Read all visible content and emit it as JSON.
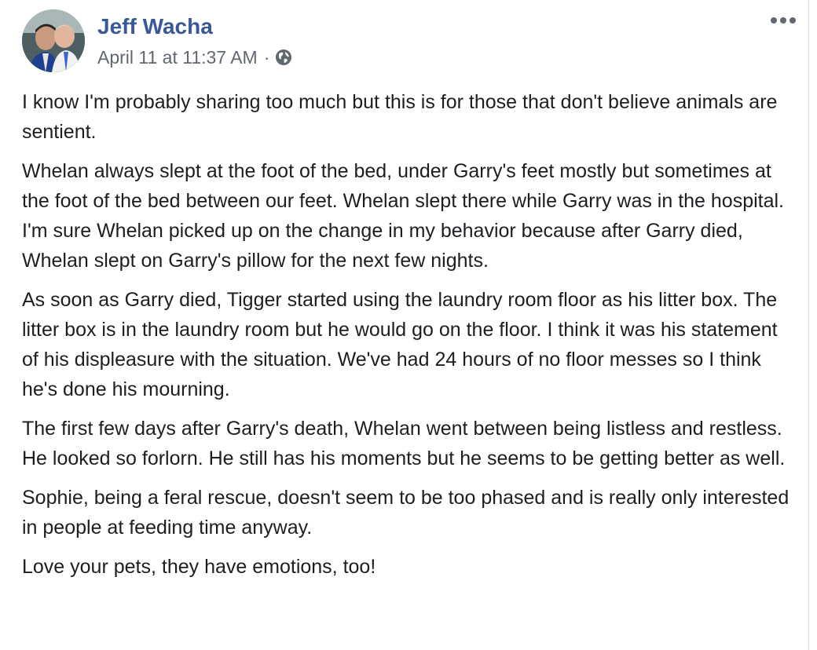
{
  "post": {
    "author": "Jeff Wacha",
    "timestamp": "April 11 at 11:37 AM",
    "separator": "·",
    "privacy_icon": "globe-icon",
    "more_icon": "more-options-icon",
    "paragraphs": [
      "I know I'm probably sharing too much but this is for those that don't believe animals are sentient.",
      "Whelan always slept at the foot of the bed, under Garry's feet mostly but sometimes at the foot of the bed between our feet. Whelan slept there while Garry was in the hospital. I'm sure Whelan picked up on the change in my behavior because after Garry died, Whelan slept on Garry's pillow for the next few nights.",
      "As soon as Garry died, Tigger started using the laundry room floor as his litter box. The litter box is in the laundry room but he would go on the floor. I think it was his statement of his displeasure with the situation. We've had 24 hours of no floor messes so I think he's done his mourning.",
      "The first few days after Garry's death, Whelan went between being listless and restless. He looked so forlorn. He still has his moments but he seems to be getting better as well.",
      "Sophie, being a feral rescue, doesn't seem to be too phased and is really only interested in people at feeding time anyway.",
      "Love your pets, they have emotions, too!"
    ]
  },
  "colors": {
    "author_link": "#385898",
    "meta_text": "#606770",
    "body_text": "#1c1e21"
  }
}
